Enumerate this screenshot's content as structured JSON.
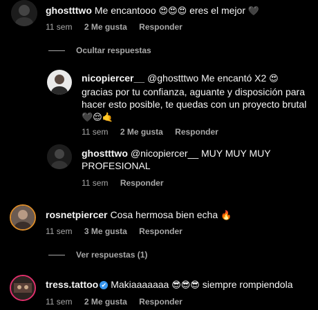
{
  "comments": [
    {
      "user": "ghostttwo",
      "text": "Me encantooo",
      "emoji1": "😍😍😍",
      "text2": "eres el mejor",
      "emoji2": "🖤",
      "time": "11 sem",
      "likes": "2 Me gusta",
      "reply": "Responder"
    },
    {
      "user": "nicopiercer__",
      "text": "@ghostttwo Me encantó X2",
      "emoji1": "😍",
      "text2": "gracias por tu confianza, aguante y disposición para hacer esto posible, te quedas con un proyecto brutal",
      "emoji2": "🖤😌🤙",
      "time": "11 sem",
      "likes": "2 Me gusta",
      "reply": "Responder"
    },
    {
      "user": "ghostttwo",
      "text": "@nicopiercer__ MUY MUY MUY PROFESIONAL",
      "time": "11 sem",
      "reply": "Responder"
    },
    {
      "user": "rosnetpiercer",
      "text": "Cosa hermosa bien echa",
      "emoji1": "🔥",
      "time": "11 sem",
      "likes": "3 Me gusta",
      "reply": "Responder"
    },
    {
      "user": "tress.tattoo",
      "text": "Makiaaaaaaa",
      "emoji1": "😎😎😎",
      "text2": "siempre rompiendola",
      "time": "11 sem",
      "likes": "2 Me gusta",
      "reply": "Responder"
    }
  ],
  "toggles": {
    "hide_replies": "Ocultar respuestas",
    "view_replies": "Ver respuestas (1)"
  },
  "colors": {
    "background": "#000000",
    "text": "#f5f5f5",
    "muted": "#a8a8a8",
    "verified": "#3897f0"
  }
}
